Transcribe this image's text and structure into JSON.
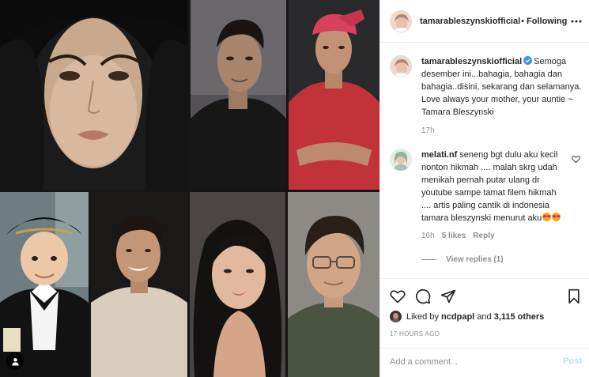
{
  "post": {
    "photo_count": 7,
    "tag_icon": "person-tag-icon"
  },
  "header": {
    "username": "tamarableszynskiofficial",
    "separator": "•",
    "follow_label": "Following",
    "more_icon": "more-options-icon"
  },
  "caption": {
    "username": "tamarableszynskiofficial",
    "verified": true,
    "text": "Semoga desember ini...bahagia, bahagia dan bahagia..disini, sekarang dan selamanya. Love always your mother, your auntie ~ Tamara Bleszynski",
    "time": "17h"
  },
  "comment": {
    "username": "melati.nf",
    "text": "seneng bgt dulu aku kecil nonton hikmah .... malah skrg udah menikah pernah putar ulang dr youtube sampe tamat filem hikmah .... artis paling cantik di indonesia tamara bleszynski menurut aku",
    "emoji": "heart-eyes-emoji",
    "time": "16h",
    "likes": "5 likes",
    "reply_label": "Reply",
    "view_replies": "View replies (1)"
  },
  "actions": {
    "like_icon": "heart-icon",
    "comment_icon": "comment-icon",
    "share_icon": "share-icon",
    "save_icon": "bookmark-icon"
  },
  "likes": {
    "prefix": "Liked by",
    "user": "ncdpapl",
    "conjunction": "and",
    "count": "3,115 others"
  },
  "timestamp": "17 HOURS AGO",
  "add_comment": {
    "placeholder": "Add a comment...",
    "post_label": "Post"
  },
  "colors": {
    "text": "#262626",
    "secondary": "#8e8e8e",
    "verified": "#3897f0",
    "post_disabled": "#b2dffc",
    "border": "#efefef"
  }
}
